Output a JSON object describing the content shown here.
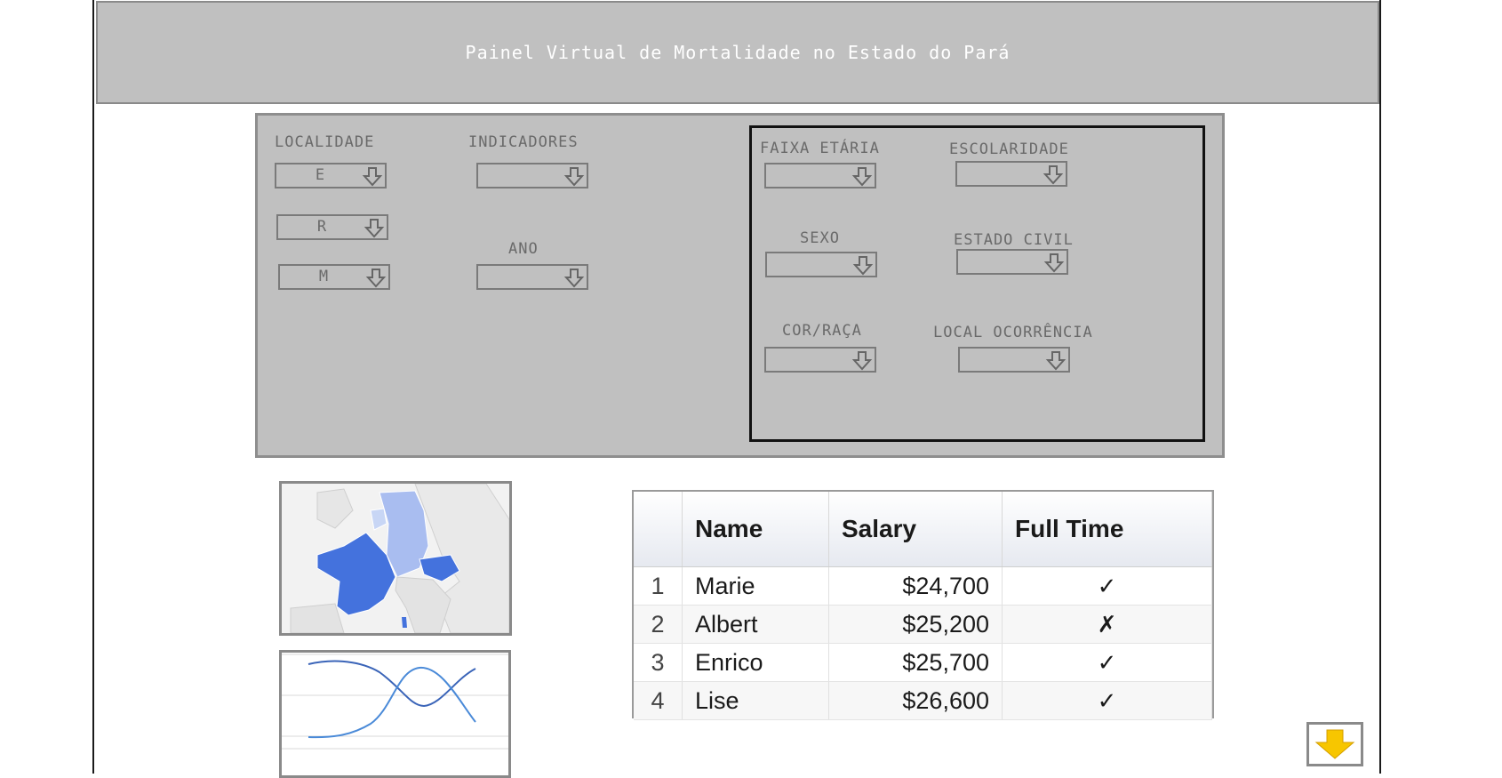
{
  "header": {
    "title": "Painel Virtual de Mortalidade no Estado do Pará"
  },
  "filters": {
    "localidade": {
      "label": "LOCALIDADE",
      "estado": "E",
      "regiao": "R",
      "municipio": "M"
    },
    "indicadores": {
      "label": "INDICADORES",
      "value": ""
    },
    "ano": {
      "label": "ANO",
      "value": ""
    },
    "faixa_etaria": {
      "label": "FAIXA ETÁRIA",
      "value": ""
    },
    "escolaridade": {
      "label": "ESCOLARIDADE",
      "value": ""
    },
    "sexo": {
      "label": "SEXO",
      "value": ""
    },
    "estado_civil": {
      "label": "ESTADO CIVIL",
      "value": ""
    },
    "cor_raca": {
      "label": "COR/RAÇA",
      "value": ""
    },
    "local_ocorrencia": {
      "label": "LOCAL OCORRÊNCIA",
      "value": ""
    }
  },
  "table": {
    "columns": [
      "",
      "Name",
      "Salary",
      "Full Time"
    ],
    "rows": [
      {
        "num": "1",
        "name": "Marie",
        "salary": "$24,700",
        "full_time": "✓"
      },
      {
        "num": "2",
        "name": "Albert",
        "salary": "$25,200",
        "full_time": "✗"
      },
      {
        "num": "3",
        "name": "Enrico",
        "salary": "$25,700",
        "full_time": "✓"
      },
      {
        "num": "4",
        "name": "Lise",
        "salary": "$26,600",
        "full_time": "✓"
      }
    ]
  },
  "icons": {
    "dropdown": "down-arrow-icon",
    "scroll_button": "yellow-down-arrow-icon"
  },
  "colors": {
    "panel": "#c0c0c0",
    "map_dark": "#4472dd",
    "map_light": "#a9bdf0",
    "arrow_yellow": "#f7c600"
  }
}
